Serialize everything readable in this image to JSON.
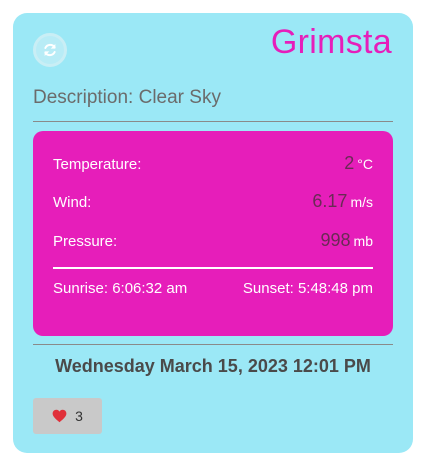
{
  "city": "Grimsta",
  "description": "Description: Clear Sky",
  "refresh_icon": "refresh-icon",
  "stats": {
    "temperature": {
      "label": "Temperature:",
      "value": "2",
      "unit": "°C"
    },
    "wind": {
      "label": "Wind:",
      "value": "6.17",
      "unit": "m/s"
    },
    "pressure": {
      "label": "Pressure:",
      "value": "998",
      "unit": "mb"
    },
    "sunrise": "Sunrise: 6:06:32 am",
    "sunset": "Sunset: 5:48:48 pm"
  },
  "datetime": "Wednesday March 15, 2023 12:01 PM",
  "likes": {
    "icon": "heart-icon",
    "count": "3"
  },
  "colors": {
    "card_bg": "#9be8f6",
    "accent": "#e61eba",
    "like_bg": "#c9c9c9",
    "heart": "#e0303a"
  }
}
